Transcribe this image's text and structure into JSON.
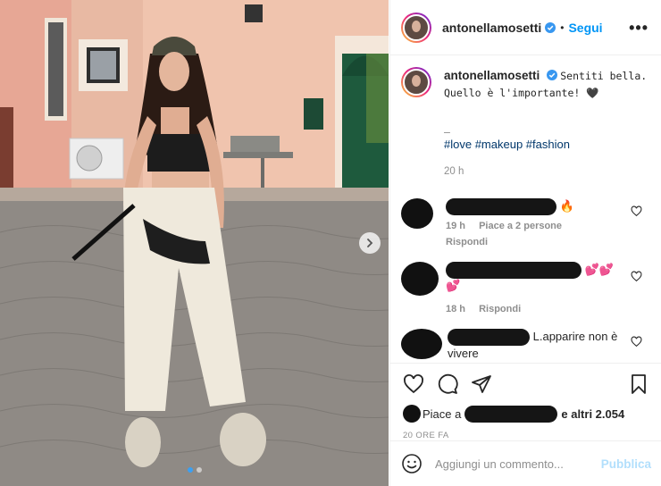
{
  "post": {
    "username": "antonellamosetti",
    "follow_label": "Segui",
    "separator": "•",
    "more_label": "•••"
  },
  "caption": {
    "username": "antonellamosetti",
    "line1": "Sentiti bella.",
    "line2": "Quello è l'importante! 🖤",
    "line3": "_",
    "hashtags": "#love #makeup #fashion",
    "time": "20 h"
  },
  "comments": [
    {
      "text_suffix": "🔥",
      "time": "19 h",
      "likes": "Piace a 2 persone",
      "reply": "Rispondi"
    },
    {
      "text_suffix": "💕💕💕",
      "time": "18 h",
      "reply": "Rispondi"
    },
    {
      "text_suffix": "L.apparire non è vivere"
    }
  ],
  "likes": {
    "prefix": "Piace a",
    "suffix": "e altri 2.054"
  },
  "post_time": "20 ORE FA",
  "compose": {
    "placeholder": "Aggiungi un commento...",
    "publish_label": "Pubblica"
  },
  "icons": {
    "verified": "verified-badge-icon",
    "like": "heart-icon",
    "comment": "comment-icon",
    "share": "paper-plane-icon",
    "save": "bookmark-icon",
    "emoji": "emoji-icon",
    "next": "chevron-right-icon"
  },
  "colors": {
    "accent": "#0095f6",
    "publish_disabled": "#b2dffc",
    "secondary_text": "#8e8e8e",
    "hashtag": "#00376b"
  },
  "carousel": {
    "slides": 2,
    "active": 0
  }
}
